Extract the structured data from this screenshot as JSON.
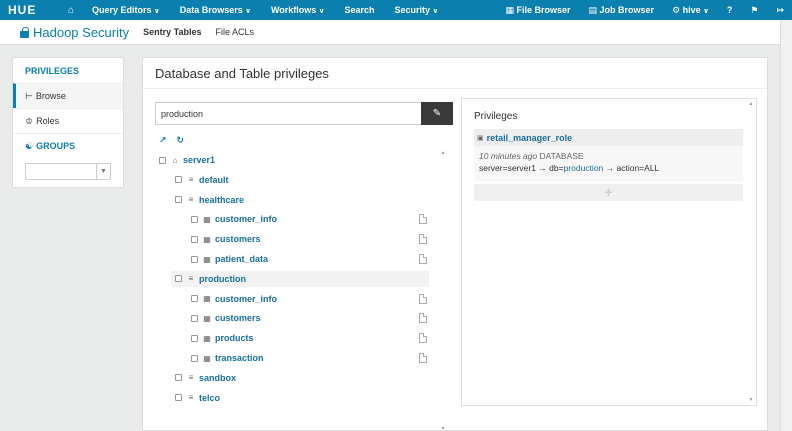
{
  "navbar": {
    "logo": "HUE",
    "menu": [
      {
        "label": "Query Editors",
        "caret": "∨"
      },
      {
        "label": "Data Browsers",
        "caret": "∨"
      },
      {
        "label": "Workflows",
        "caret": "∨"
      },
      {
        "label": "Search",
        "caret": ""
      },
      {
        "label": "Security",
        "caret": "∨"
      }
    ],
    "right": {
      "file_browser": "File Browser",
      "job_browser": "Job Browser",
      "user": "hive",
      "user_caret": "∨"
    }
  },
  "app": {
    "title": "Hadoop Security",
    "tabs": [
      "Sentry Tables",
      "File ACLs"
    ]
  },
  "sidebar": {
    "privileges_header": "PRIVILEGES",
    "browse_label": "Browse",
    "roles_label": "Roles",
    "groups_header": "GROUPS",
    "group_select_value": ""
  },
  "main": {
    "title": "Database and Table privileges",
    "search_value": "production",
    "tree": [
      {
        "label": "server1",
        "level": 0,
        "kind": "server"
      },
      {
        "label": "default",
        "level": 1,
        "kind": "db"
      },
      {
        "label": "healthcare",
        "level": 1,
        "kind": "db"
      },
      {
        "label": "customer_info",
        "level": 2,
        "kind": "table"
      },
      {
        "label": "customers",
        "level": 2,
        "kind": "table"
      },
      {
        "label": "patient_data",
        "level": 2,
        "kind": "table"
      },
      {
        "label": "production",
        "level": 1,
        "kind": "db",
        "highlighted": true
      },
      {
        "label": "customer_info",
        "level": 2,
        "kind": "table"
      },
      {
        "label": "customers",
        "level": 2,
        "kind": "table"
      },
      {
        "label": "products",
        "level": 2,
        "kind": "table"
      },
      {
        "label": "transaction",
        "level": 2,
        "kind": "table"
      },
      {
        "label": "sandbox",
        "level": 1,
        "kind": "db"
      },
      {
        "label": "telco",
        "level": 1,
        "kind": "db"
      }
    ]
  },
  "privileges": {
    "title": "Privileges",
    "role": "retail_manager_role",
    "time_ago": "10 minutes ago",
    "scope": "DATABASE",
    "server_part": "server=server1 → db=",
    "db_value": "production",
    "action_part": " → action=ALL",
    "add_symbol": "+"
  },
  "colors": {
    "navbar": "#0b7fad",
    "link": "#1a6fa0",
    "search_button": "#3a3a3a"
  }
}
